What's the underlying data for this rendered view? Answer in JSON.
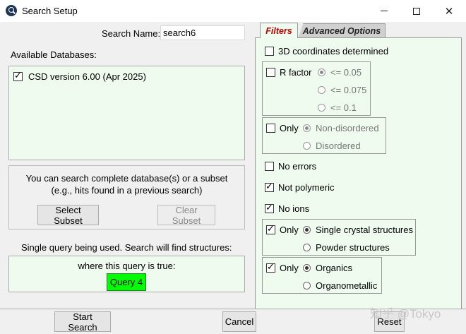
{
  "window": {
    "title": "Search Setup",
    "controls": {
      "minimize": "minimize-icon",
      "maximize": "maximize-icon",
      "close": "close-icon"
    }
  },
  "left": {
    "search_name_label": "Search Name:",
    "search_name_value": "search6",
    "available_label": "Available Databases:",
    "databases": [
      {
        "label": "CSD version 6.00 (Apr 2025)",
        "checked": true
      }
    ],
    "subset_info_line1": "You can search complete database(s) or a subset",
    "subset_info_line2": "(e.g., hits found in a previous search)",
    "select_subset": "Select Subset",
    "clear_subset": "Clear Subset",
    "query_info": "Single query being used. Search will find structures:",
    "query_where": "where this query is true:",
    "query_button": "Query 4"
  },
  "tabs": {
    "filters": "Filters",
    "advanced": "Advanced Options"
  },
  "filters": {
    "coords_3d": "3D coordinates determined",
    "r_factor": "R factor",
    "r_options": [
      "<= 0.05",
      "<= 0.075",
      "<= 0.1"
    ],
    "only_label": "Only",
    "disorder_options": [
      "Non-disordered",
      "Disordered"
    ],
    "no_errors": "No errors",
    "not_polymeric": "Not polymeric",
    "no_ions": "No ions",
    "crystal_options": [
      "Single crystal structures",
      "Powder structures"
    ],
    "organic_options": [
      "Organics",
      "Organometallic"
    ]
  },
  "bottom": {
    "start_search": "Start Search",
    "cancel": "Cancel",
    "reset": "Reset"
  },
  "watermark": "知乎 @Tokyo",
  "colors": {
    "panel_bg": "#eefbee",
    "query_green": "#00ff00",
    "active_tab_text": "#c00000"
  }
}
